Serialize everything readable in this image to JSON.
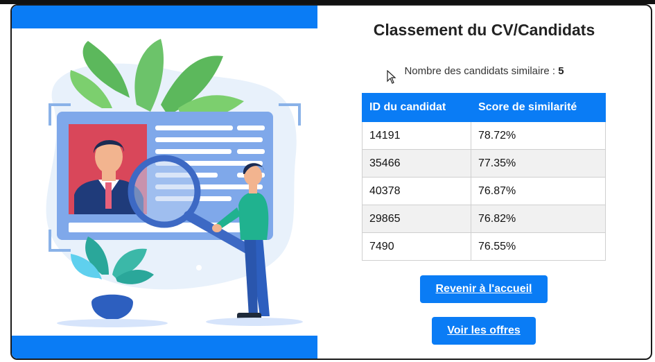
{
  "page": {
    "title": "Classement du CV/Candidats",
    "count_label": "Nombre des candidats similaire : ",
    "count_value": "5"
  },
  "table": {
    "headers": [
      "ID du candidat",
      "Score de similarité"
    ],
    "rows": [
      {
        "id": "14191",
        "score": "78.72%"
      },
      {
        "id": "35466",
        "score": "77.35%"
      },
      {
        "id": "40378",
        "score": "76.87%"
      },
      {
        "id": "29865",
        "score": "76.82%"
      },
      {
        "id": "7490",
        "score": "76.55%"
      }
    ]
  },
  "buttons": {
    "home": "Revenir à l'accueil",
    "offers": "Voir les offres"
  },
  "colors": {
    "accent": "#0a7cf5",
    "row_alt": "#f1f1f1"
  },
  "icons": {
    "illustration": "cv-search-illustration",
    "cursor": "mouse-pointer-icon"
  }
}
